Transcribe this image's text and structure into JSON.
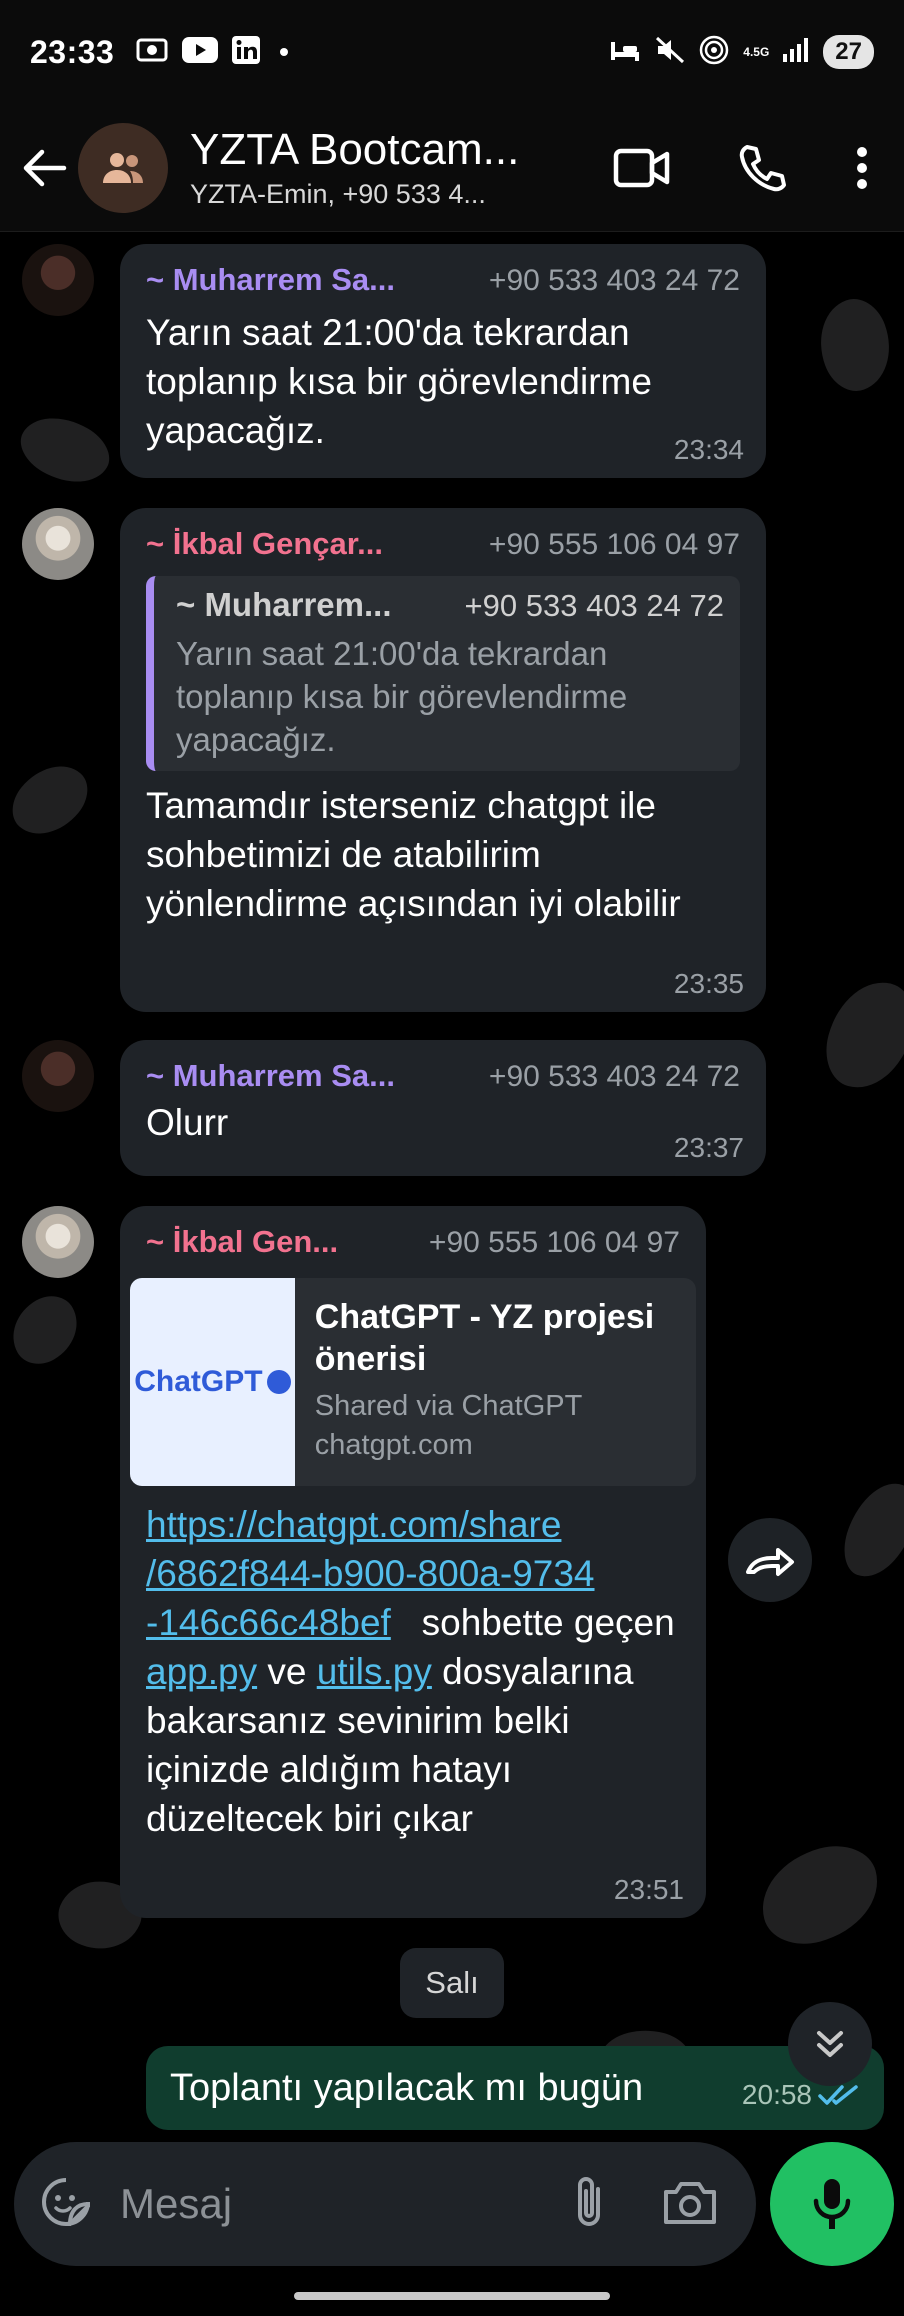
{
  "status_bar": {
    "time": "23:33",
    "network": "4.5G",
    "battery": "27"
  },
  "header": {
    "group_name": "YZTA Bootcam...",
    "participants": "YZTA-Emin, +90 533 4..."
  },
  "messages": [
    {
      "sender": "~ Muharrem Sa...",
      "phone": "+90 533 403 24 72",
      "text": "Yarın saat 21:00'da tekrardan toplanıp kısa bir görevlendirme yapacağız.",
      "time": "23:34"
    },
    {
      "sender": "~ İkbal Gençar...",
      "phone": "+90 555 106 04 97",
      "quote": {
        "sender": "~ Muharrem...",
        "phone": "+90 533 403 24 72",
        "text": "Yarın saat 21:00'da tekrardan toplanıp kısa bir görevlendirme yapacağız."
      },
      "text": "Tamamdır isterseniz chatgpt ile sohbetimizi de atabilirim yönlendirme açısından iyi olabilir",
      "time": "23:35"
    },
    {
      "sender": "~ Muharrem Sa...",
      "phone": "+90 533 403 24 72",
      "text": "Olurr",
      "time": "23:37"
    },
    {
      "sender": "~ İkbal Gen...",
      "phone": "+90 555 106 04 97",
      "preview": {
        "logo": "ChatGPT",
        "title": "ChatGPT - YZ projesi önerisi",
        "subtitle": "Shared via ChatGPT",
        "domain": "chatgpt.com"
      },
      "link_line1": "https://chatgpt.com/share",
      "link_line2": "/6862f844-b900-800a-9734",
      "link_line3": "-146c66c48bef",
      "text_after_link": "sohbette geçen",
      "file1": "app.py",
      "and": "ve",
      "file2": "utils.py",
      "text_end": "dosyalarına bakarsanız sevinirim belki içinizde aldığım hatayı düzeltecek biri çıkar",
      "time": "23:51"
    }
  ],
  "day_separator": "Salı",
  "outgoing": {
    "text": "Toplantı yapılacak mı bugün",
    "time": "20:58"
  },
  "composer": {
    "placeholder": "Mesaj"
  },
  "icons": [
    "back-arrow-icon",
    "group-icon",
    "video-call-icon",
    "phone-icon",
    "more-icon",
    "sticker-icon",
    "attach-icon",
    "camera-icon",
    "mic-icon",
    "forward-icon",
    "chevron-double-down-icon",
    "double-check-icon"
  ],
  "colors": {
    "accent_green": "#21c063",
    "outgoing_bubble": "#103d2e",
    "incoming_bubble": "#1f2328",
    "link": "#53bdeb",
    "sender_purple": "#a98df2",
    "sender_pink": "#f2728f"
  }
}
